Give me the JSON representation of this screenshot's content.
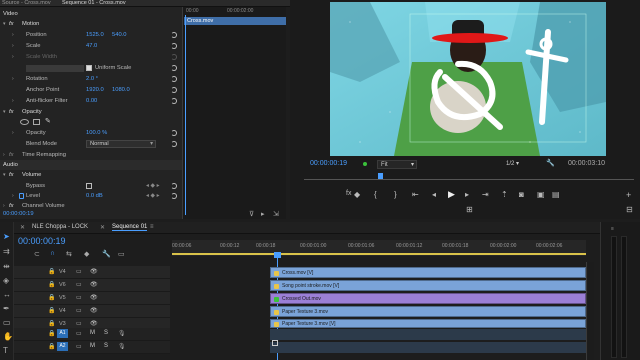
{
  "top_tabs": [
    "Source - Cross.mov",
    "Sequence 01 - Cross.mov"
  ],
  "fx_timeline": {
    "ruler_left": "00:00",
    "ruler_right": "00:00:02:00",
    "clip_label": "Cross.mov",
    "timecode": "00:00:00:19"
  },
  "effect_controls": {
    "video_header": "Video",
    "motion": "Motion",
    "position_label": "Position",
    "position_x": "1525.0",
    "position_y": "540.0",
    "scale_label": "Scale",
    "scale_val": "47.0",
    "scale_width_label": "Scale Width",
    "uniform_scale": "Uniform Scale",
    "rotation_label": "Rotation",
    "rotation_val": "2.0 °",
    "anchor_label": "Anchor Point",
    "anchor_x": "1920.0",
    "anchor_y": "1080.0",
    "flicker_label": "Anti-flicker Filter",
    "flicker_val": "0.00",
    "opacity_header": "Opacity",
    "opacity_label": "Opacity",
    "opacity_val": "100.0 %",
    "blend_label": "Blend Mode",
    "blend_val": "Normal",
    "time_remap": "Time Remapping",
    "audio_header": "Audio",
    "volume_header": "Volume",
    "bypass_label": "Bypass",
    "level_label": "Level",
    "level_val": "0.0 dB",
    "channel_volume": "Channel Volume"
  },
  "program": {
    "timecode_left": "00:00:00:19",
    "fit": "Fit",
    "ratio": "1/2",
    "timecode_right": "00:00:03:10"
  },
  "timeline": {
    "tabs": [
      "NLE Choppa - LOCK",
      "Sequence 01"
    ],
    "timecode": "00:00:00:19",
    "ruler": [
      "00:00:06",
      "00:00:12",
      "00:00:18",
      "00:00:01:00",
      "00:00:01:06",
      "00:00:01:12",
      "00:00:01:18",
      "00:00:02:00",
      "00:00:02:06"
    ],
    "tracks": [
      {
        "name": "V4"
      },
      {
        "name": "V6"
      },
      {
        "name": "V5"
      },
      {
        "name": "V4"
      },
      {
        "name": "V3"
      },
      {
        "name": "V2"
      },
      {
        "name": "A1"
      },
      {
        "name": "A2"
      }
    ],
    "clips": [
      "Cross.mov [V]",
      "Song point stroke.mov [V]",
      "Crossed Out.mov",
      "Paper Texture 3.mov",
      "Paper Texture 3.mov [V]"
    ],
    "audio_ab": [
      "M",
      "S"
    ]
  },
  "colors": {
    "accent": "#4a9eff",
    "clip_blue": "#7aa3d8",
    "clip_green": "#7fbf7a",
    "clip_purple": "#9b7fd6"
  }
}
